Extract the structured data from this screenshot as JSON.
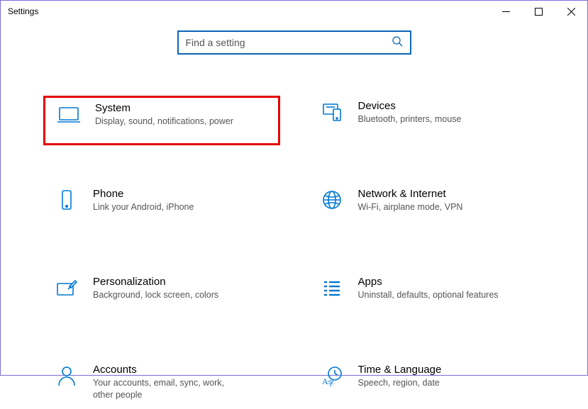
{
  "window": {
    "title": "Settings"
  },
  "search": {
    "placeholder": "Find a setting",
    "value": ""
  },
  "categories": [
    {
      "id": "system",
      "title": "System",
      "desc": "Display, sound, notifications, power",
      "highlighted": true
    },
    {
      "id": "devices",
      "title": "Devices",
      "desc": "Bluetooth, printers, mouse",
      "highlighted": false
    },
    {
      "id": "phone",
      "title": "Phone",
      "desc": "Link your Android, iPhone",
      "highlighted": false
    },
    {
      "id": "network",
      "title": "Network & Internet",
      "desc": "Wi-Fi, airplane mode, VPN",
      "highlighted": false
    },
    {
      "id": "personalization",
      "title": "Personalization",
      "desc": "Background, lock screen, colors",
      "highlighted": false
    },
    {
      "id": "apps",
      "title": "Apps",
      "desc": "Uninstall, defaults, optional features",
      "highlighted": false
    },
    {
      "id": "accounts",
      "title": "Accounts",
      "desc": "Your accounts, email, sync, work, other people",
      "highlighted": false
    },
    {
      "id": "time",
      "title": "Time & Language",
      "desc": "Speech, region, date",
      "highlighted": false
    }
  ]
}
